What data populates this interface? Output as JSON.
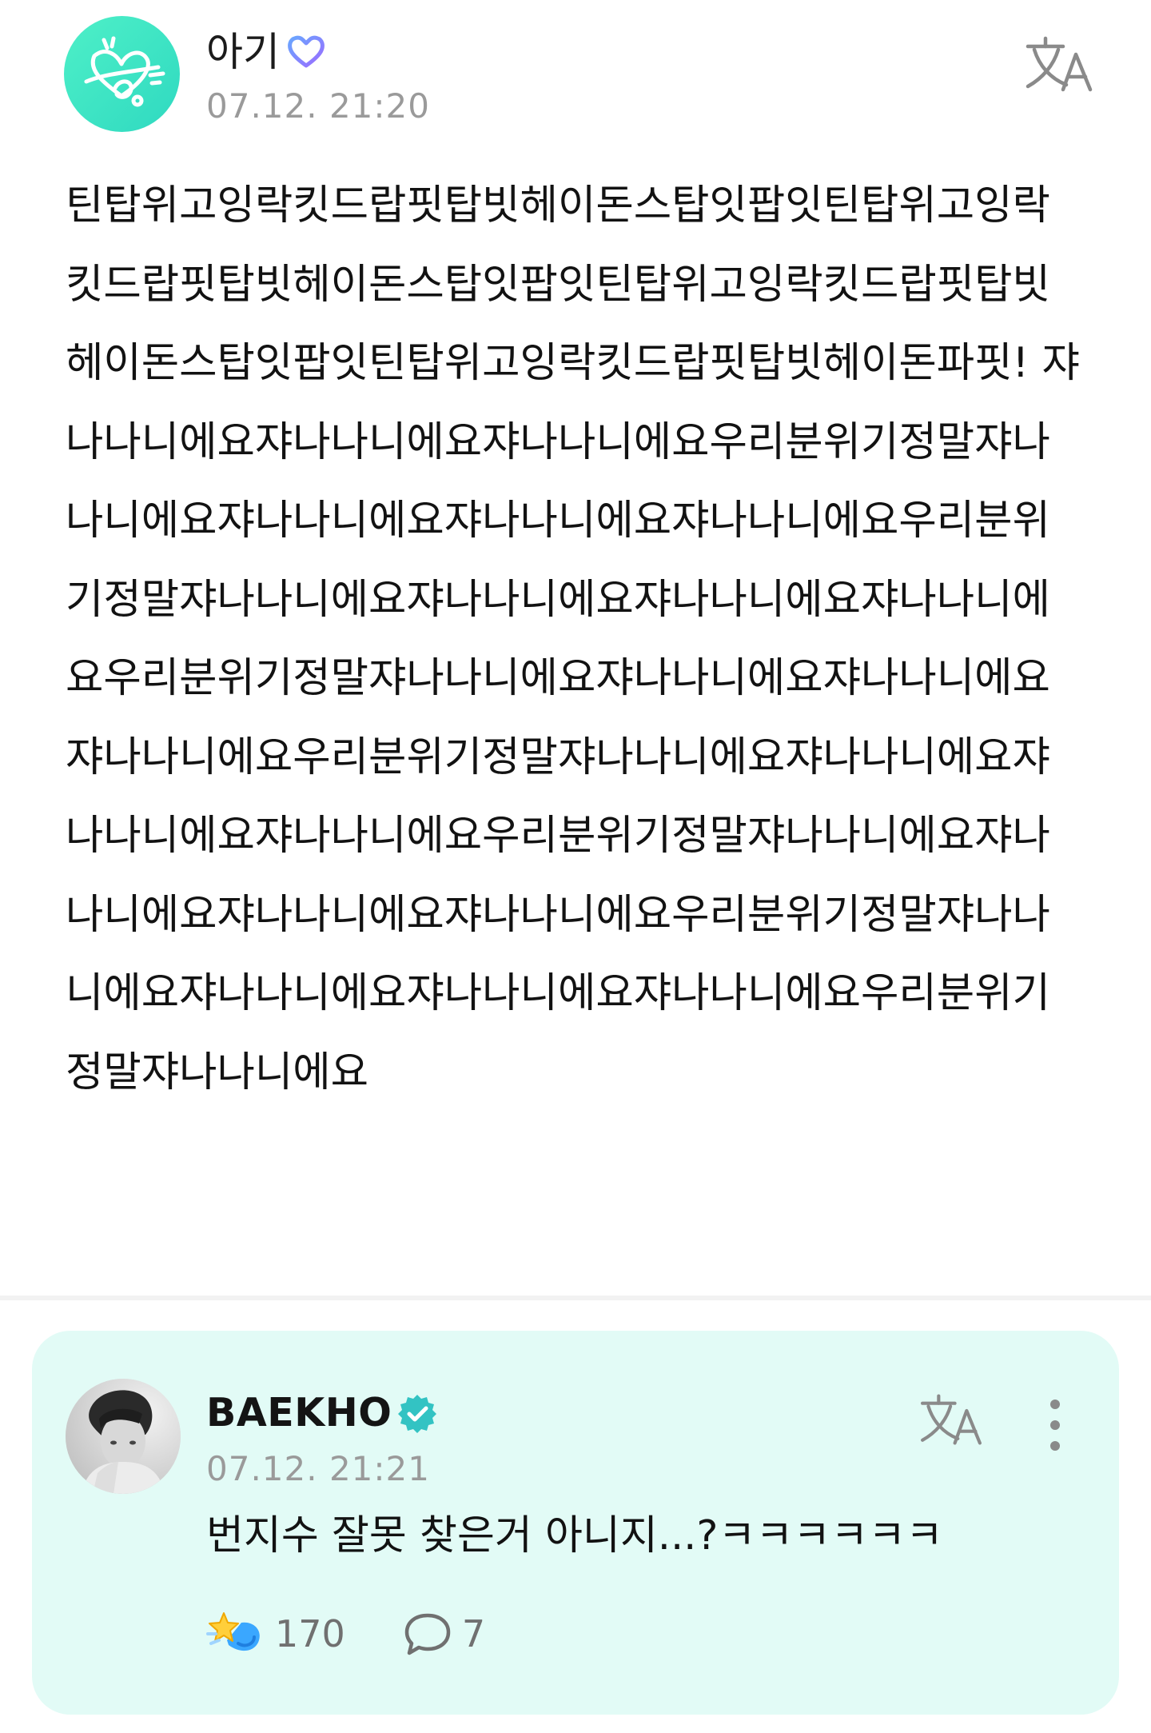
{
  "post": {
    "author": "아기",
    "time": "07.12. 21:20",
    "body": "틴탑위고잉락킷드랍핏탑빗헤이돈스탑잇팝잇틴탑위고잉락킷드랍핏탑빗헤이돈스탑잇팝잇틴탑위고잉락킷드랍핏탑빗헤이돈스탑잇팝잇틴탑위고잉락킷드랍핏탑빗헤이돈파핏! 쟈나나니에요쟈나나니에요쟈나나니에요우리분위기정말쟈나나니에요쟈나나니에요쟈나나니에요쟈나나니에요우리분위기정말쟈나나니에요쟈나나니에요쟈나나니에요쟈나나니에요우리분위기정말쟈나나니에요쟈나나니에요쟈나나니에요쟈나나니에요우리분위기정말쟈나나니에요쟈나나니에요쟈나나니에요쟈나나니에요우리분위기정말쟈나나니에요쟈나나니에요쟈나나니에요쟈나나니에요우리분위기정말쟈나나니에요쟈나나니에요쟈나나니에요쟈나나니에요우리분위기정말쟈나나니에요",
    "icons": {
      "translate": "translate-icon",
      "badge": "heart-badge-icon"
    }
  },
  "comment": {
    "author": "BAEKHO",
    "time": "07.12. 21:21",
    "text": "번지수 잘못 찾은거 아니지...?ㅋㅋㅋㅋㅋㅋ",
    "likes": "170",
    "replies": "7",
    "icons": {
      "verified": "verified-badge-icon",
      "translate": "translate-icon",
      "more": "more-vertical-icon",
      "like": "like-reaction-icon",
      "reply": "comment-bubble-icon"
    }
  },
  "colors": {
    "comment_card_bg": "#e2fbf6",
    "timestamp": "#9a9a9a",
    "verified": "#33c3c3",
    "post_avatar_bg": "#35e1c3"
  }
}
